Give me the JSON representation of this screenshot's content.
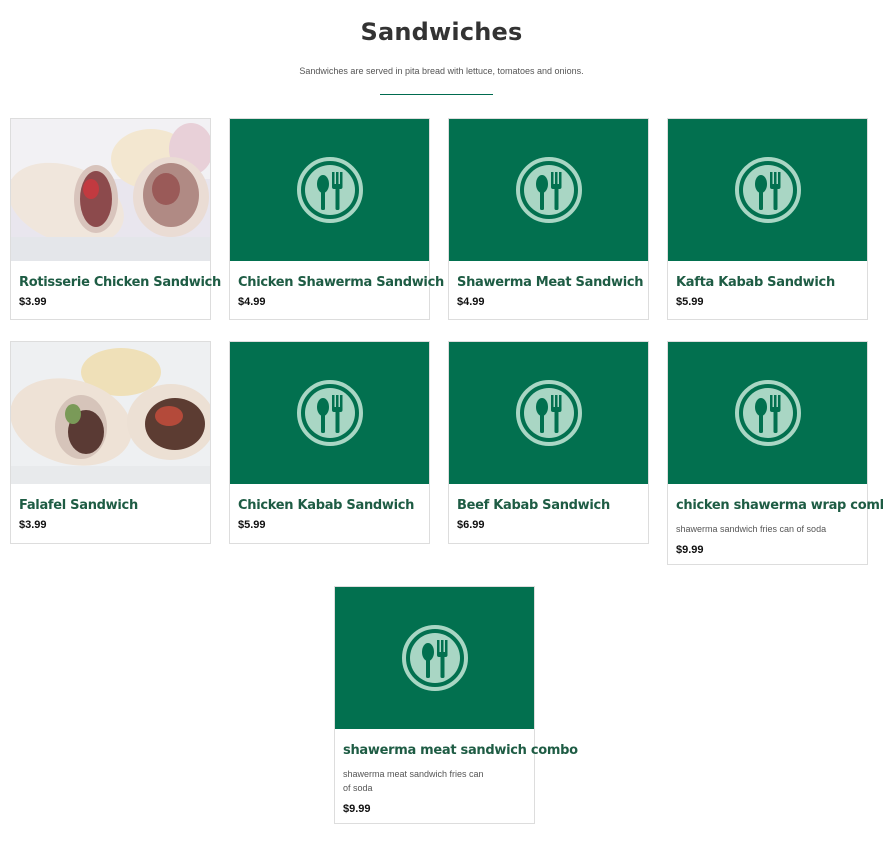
{
  "header": {
    "title": "Sandwiches",
    "subtitle": "Sandwiches are served in pita bread with lettuce, tomatoes and onions."
  },
  "items": [
    {
      "name": "Rotisserie Chicken Sandwich",
      "price": "$3.99",
      "image": "photo-chicken-wrap"
    },
    {
      "name": "Chicken Shawerma Sandwich",
      "price": "$4.99",
      "image": "plate-utensils-icon"
    },
    {
      "name": "Shawerma Meat Sandwich",
      "price": "$4.99",
      "image": "plate-utensils-icon"
    },
    {
      "name": "Kafta Kabab Sandwich",
      "price": "$5.99",
      "image": "plate-utensils-icon"
    },
    {
      "name": "Falafel Sandwich",
      "price": "$3.99",
      "image": "photo-falafel-wrap"
    },
    {
      "name": "Chicken Kabab Sandwich",
      "price": "$5.99",
      "image": "plate-utensils-icon"
    },
    {
      "name": "Beef Kabab Sandwich",
      "price": "$6.99",
      "image": "plate-utensils-icon"
    },
    {
      "name": "chicken shawerma wrap combo",
      "description": "shawerma sandwich fries can of soda",
      "price": "$9.99",
      "image": "plate-utensils-icon"
    },
    {
      "name": "shawerma meat sandwich combo",
      "description": "shawerma meat sandwich fries can of soda",
      "price": "$9.99",
      "image": "plate-utensils-icon"
    }
  ],
  "colors": {
    "brand_green": "#02704f",
    "title_green": "#1e5c44",
    "icon_tint": "#a9d6c4"
  }
}
